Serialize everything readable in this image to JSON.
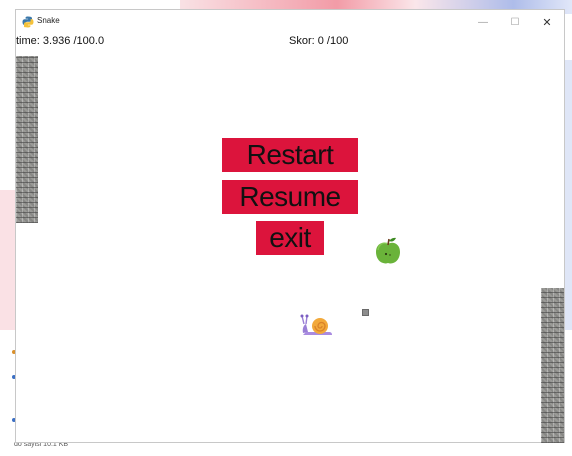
{
  "window": {
    "title": "Snake",
    "minimize_glyph": "—",
    "maximize_glyph": "☐",
    "close_glyph": "✕"
  },
  "hud": {
    "time": "time: 3.936 /100.0",
    "score": "Skor: 0 /100"
  },
  "menu": {
    "restart": "Restart",
    "resume": "Resume",
    "exit": "exit"
  },
  "colors": {
    "menu_button": "#dc143c",
    "background": "#ffffff"
  },
  "background_fragment": {
    "bottom_text": "do sayisi  10.1 KB"
  },
  "icons": [
    "python-icon",
    "apple-icon",
    "snail-icon",
    "wall-block",
    "pebble-icon"
  ]
}
